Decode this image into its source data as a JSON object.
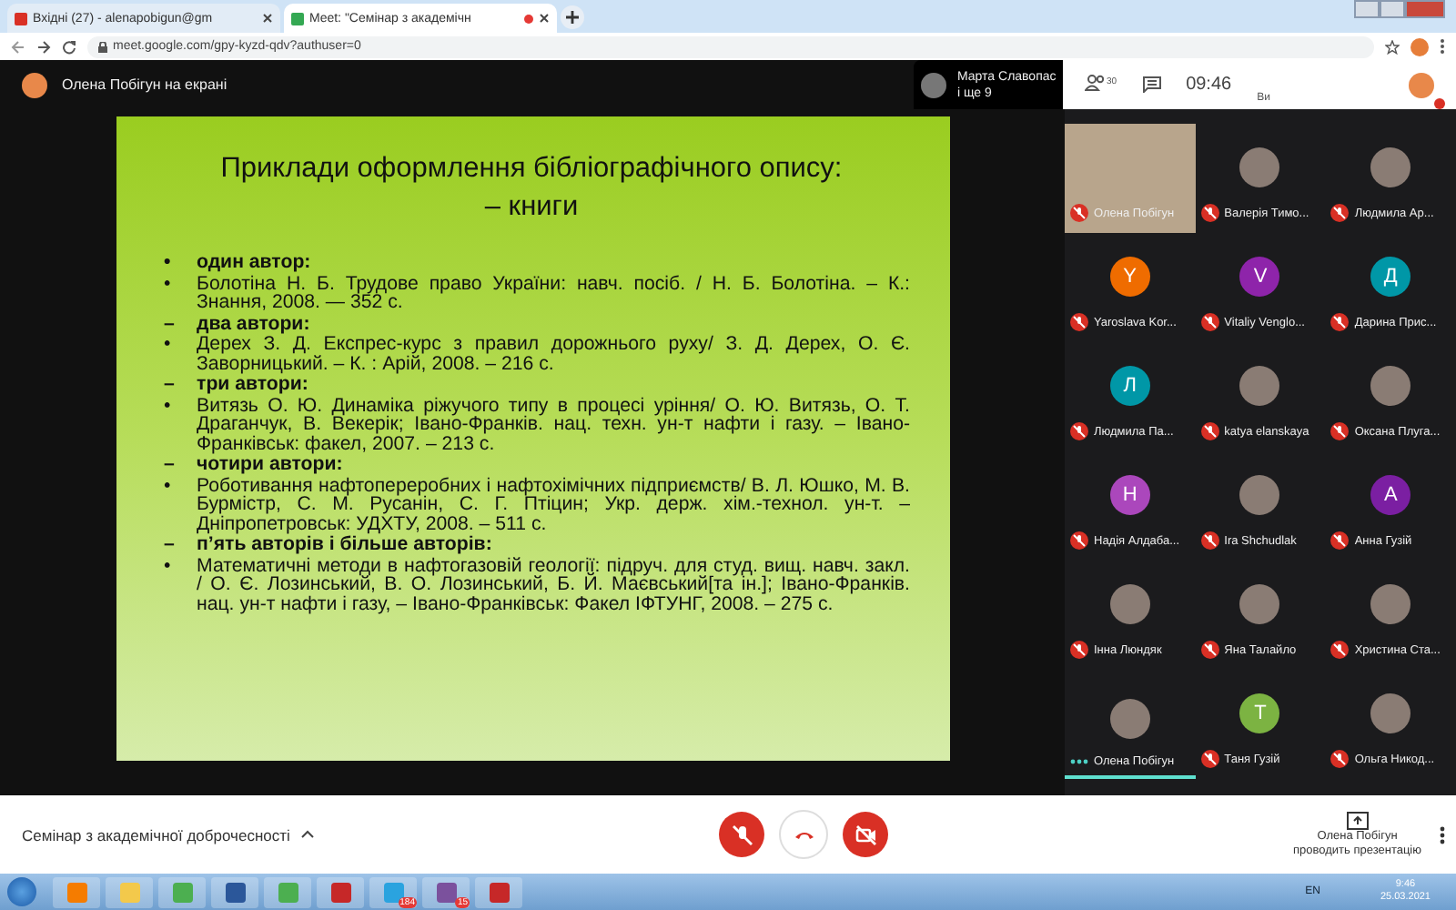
{
  "browser": {
    "tabs": [
      {
        "title": "Вхідні (27) - alenapobigun@gm",
        "selected": false,
        "recording": false
      },
      {
        "title": "Meet: \"Семінар з академічн",
        "selected": true,
        "recording": true
      }
    ],
    "url": "meet.google.com/gpy-kyzd-qdv?authuser=0"
  },
  "top_bar": {
    "presenter": "Олена Побігун на екрані",
    "pinned_name": "Марта Славопас",
    "pinned_more": "і ще 9",
    "people_count": "30",
    "time": "09:46",
    "self_label": "Ви"
  },
  "slide": {
    "title": "Приклади оформлення бібліографічного опису:",
    "subtitle": "– книги",
    "items": [
      {
        "kind": "heading",
        "marker": "•",
        "text": "один автор:"
      },
      {
        "kind": "entry",
        "marker": "•",
        "text": "Болотіна Н. Б. Трудове право України: навч. посіб. / Н. Б. Болотіна. – К.: Знання, 2008. — 352 с."
      },
      {
        "kind": "heading",
        "marker": "–",
        "text": "два автори:"
      },
      {
        "kind": "entry",
        "marker": "•",
        "text": "Дерех З. Д. Експрес-курс з правил дорожнього руху/ З. Д. Дерех, О. Є. Заворницький. – К. : Арій, 2008. – 216 с."
      },
      {
        "kind": "heading",
        "marker": "–",
        "text": "три автори:"
      },
      {
        "kind": "entry",
        "marker": "•",
        "text": "Витязь О. Ю. Динаміка ріжучого типу в процесі уріння/ О. Ю. Витязь, О. Т. Драганчук, В. Векерік; Івано-Франків. нац. техн. ун-т нафти і газу. – Івано-Франківськ: факел, 2007. – 213 с."
      },
      {
        "kind": "heading",
        "marker": "–",
        "text": "чотири автори:"
      },
      {
        "kind": "entry",
        "marker": "•",
        "text": "Роботивання нафтопереробних і нафтохімічних підприємств/ В. Л. Юшко, М. В. Бурмістр, С. М. Русанін, С. Г. Птіцин; Укр. держ. хім.-технол. ун-т. – Дніпропетровськ: УДХТУ, 2008. – 511 с."
      },
      {
        "kind": "heading",
        "marker": "–",
        "text": "п’ять авторів і більше авторів:"
      },
      {
        "kind": "entry",
        "marker": "•",
        "text": "Математичні методи в нафтогазовій геології: підруч. для студ. вищ. навч. закл. / О. Є. Лозинський, В. О. Лозинський, Б. Й. Маєвський[та ін.]; Івано-Франків. нац. ун-т нафти і газу, – Івано-Франківськ: Факел ІФТУНГ, 2008. – 275 с."
      }
    ]
  },
  "participants": [
    {
      "kind": "video",
      "name": "Олена Побігун",
      "muted": true
    },
    {
      "kind": "photo",
      "name": "Валерія Тимо...",
      "muted": true
    },
    {
      "kind": "photo",
      "name": "Людмила Ар...",
      "muted": true
    },
    {
      "kind": "letter",
      "letter": "Y",
      "color": "#ef6c00",
      "name": "Yaroslava Kor...",
      "muted": true
    },
    {
      "kind": "letter",
      "letter": "V",
      "color": "#8e24aa",
      "name": "Vitaliy Venglo...",
      "muted": true
    },
    {
      "kind": "letter",
      "letter": "Д",
      "color": "#0097a7",
      "name": "Дарина Прис...",
      "muted": true
    },
    {
      "kind": "letter",
      "letter": "Л",
      "color": "#0097a7",
      "name": "Людмила Па...",
      "muted": true
    },
    {
      "kind": "photo",
      "name": "katya elanskaya",
      "muted": true
    },
    {
      "kind": "photo",
      "name": "Оксана Плуга...",
      "muted": true
    },
    {
      "kind": "letter",
      "letter": "Н",
      "color": "#ab47bc",
      "name": "Надія Алдаба...",
      "muted": true
    },
    {
      "kind": "photo",
      "name": "Ira Shchudlak",
      "muted": true
    },
    {
      "kind": "letter",
      "letter": "А",
      "color": "#7b1fa2",
      "name": "Анна Гузій",
      "muted": true
    },
    {
      "kind": "photo",
      "name": "Інна Люндяк",
      "muted": true
    },
    {
      "kind": "photo",
      "name": "Яна Талайло",
      "muted": true
    },
    {
      "kind": "photo",
      "name": "Христина Ста...",
      "muted": true
    },
    {
      "kind": "photo",
      "name": "Олена Побігун",
      "muted": false
    },
    {
      "kind": "letter",
      "letter": "Т",
      "color": "#7cb342",
      "name": "Таня Гузій",
      "muted": true
    },
    {
      "kind": "photo",
      "name": "Ольга Никод...",
      "muted": true
    }
  ],
  "bottom_bar": {
    "meeting_title": "Семінар з академічної доброчесності",
    "presenting_name": "Олена Побігун",
    "presenting_text": "проводить презентацію"
  },
  "taskbar": {
    "apps": [
      {
        "kind": "media"
      },
      {
        "kind": "folder"
      },
      {
        "kind": "chrome"
      },
      {
        "kind": "word"
      },
      {
        "kind": "chrome"
      },
      {
        "kind": "app"
      },
      {
        "kind": "telegram",
        "badge": "184"
      },
      {
        "kind": "viber",
        "badge": "15"
      },
      {
        "kind": "app"
      }
    ],
    "language": "EN",
    "time": "9:46",
    "date": "25.03.2021"
  }
}
